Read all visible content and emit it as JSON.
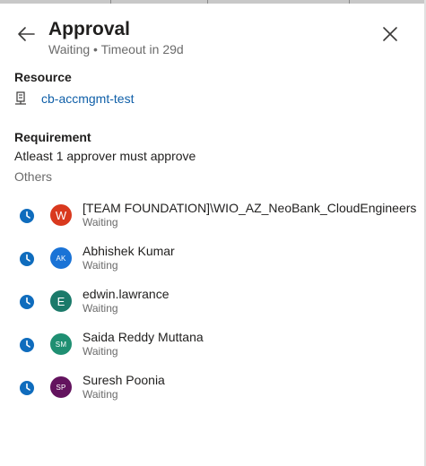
{
  "header": {
    "title": "Approval",
    "subtitle": "Waiting • Timeout in 29d"
  },
  "resource": {
    "label": "Resource",
    "name": "cb-accmgmt-test",
    "icon": "server-icon"
  },
  "requirement": {
    "label": "Requirement",
    "text": "Atleast 1 approver must approve",
    "group": "Others"
  },
  "approvers": [
    {
      "name": "[TEAM FOUNDATION]\\WIO_AZ_NeoBank_CloudEngineers",
      "status": "Waiting",
      "initials": "W",
      "color": "#d9391e"
    },
    {
      "name": "Abhishek Kumar",
      "status": "Waiting",
      "initials": "AK",
      "color": "#1a73d6"
    },
    {
      "name": "edwin.lawrance",
      "status": "Waiting",
      "initials": "E",
      "color": "#1b7a6a"
    },
    {
      "name": "Saida Reddy Muttana",
      "status": "Waiting",
      "initials": "SM",
      "color": "#1f8f72"
    },
    {
      "name": "Suresh Poonia",
      "status": "Waiting",
      "initials": "SP",
      "color": "#63135e"
    }
  ],
  "colors": {
    "link": "#0f5fa8",
    "waiting_icon": "#0f6cbd"
  }
}
